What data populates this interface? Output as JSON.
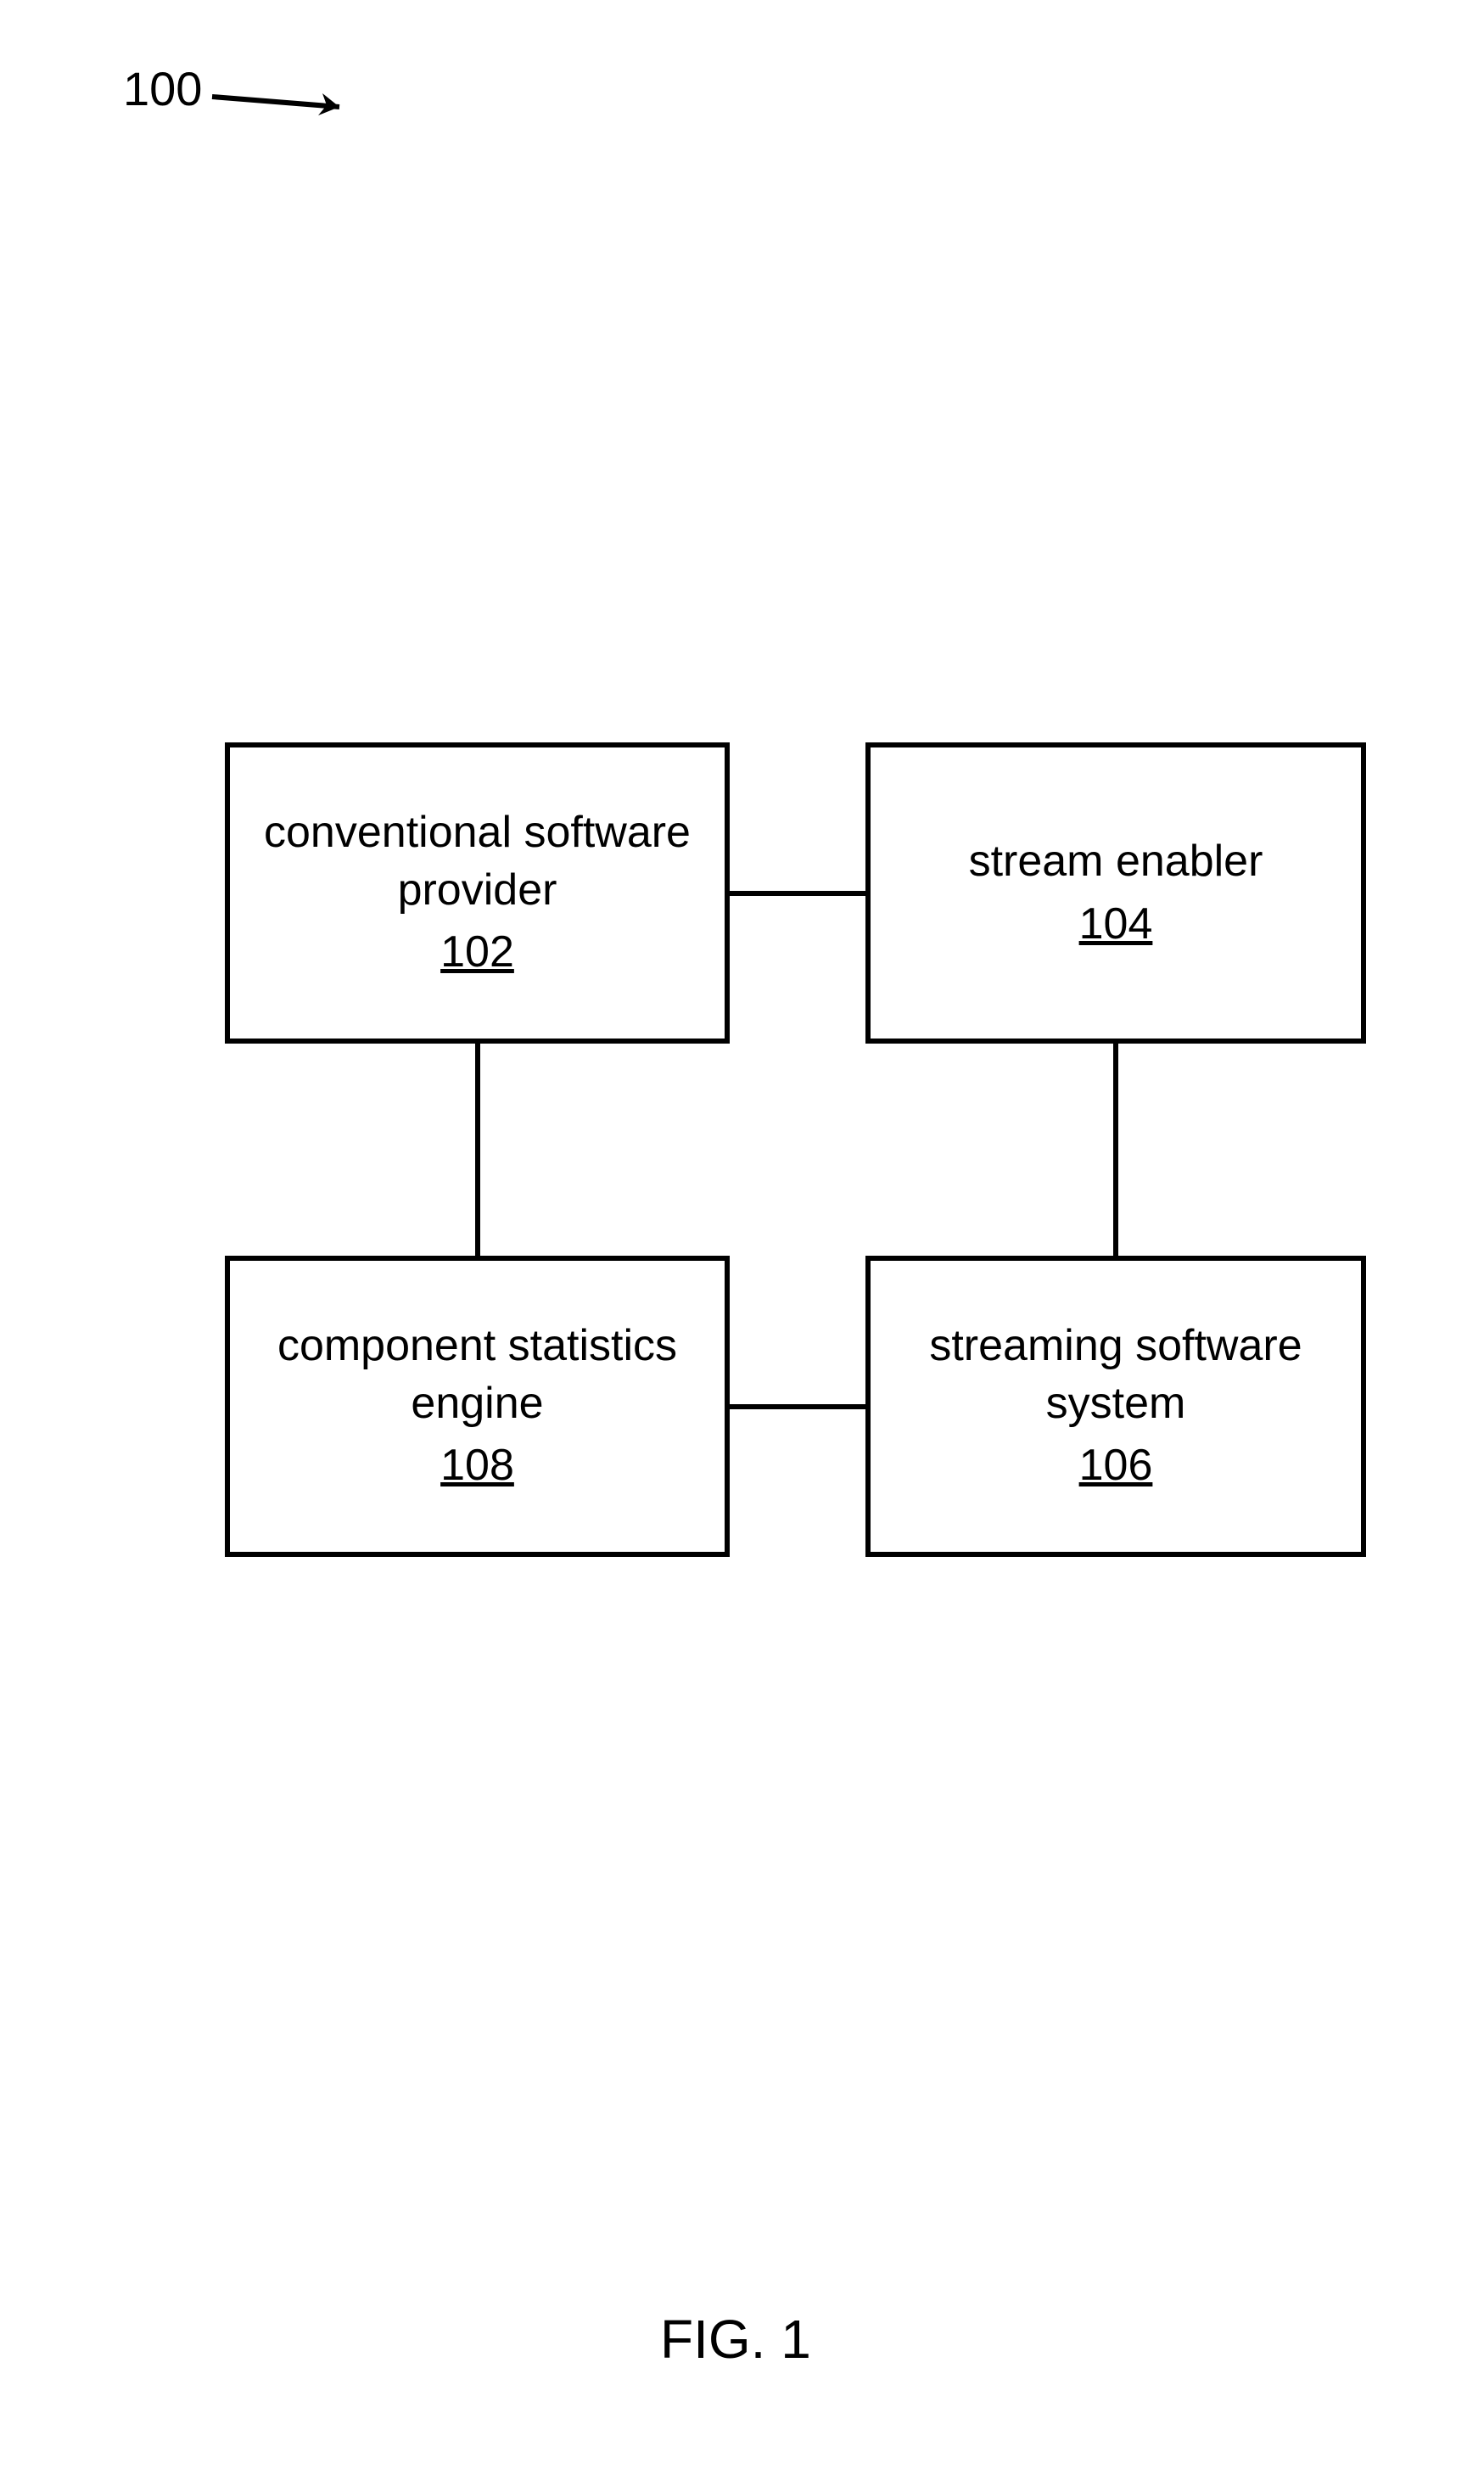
{
  "ref": {
    "label": "100"
  },
  "boxes": {
    "tl": {
      "line1": "conventional software",
      "line2": "provider",
      "num": "102"
    },
    "tr": {
      "line1": "stream enabler",
      "num": "104"
    },
    "bl": {
      "line1": "component statistics",
      "line2": "engine",
      "num": "108"
    },
    "br": {
      "line1": "streaming software",
      "line2": "system",
      "num": "106"
    }
  },
  "caption": "FIG. 1"
}
